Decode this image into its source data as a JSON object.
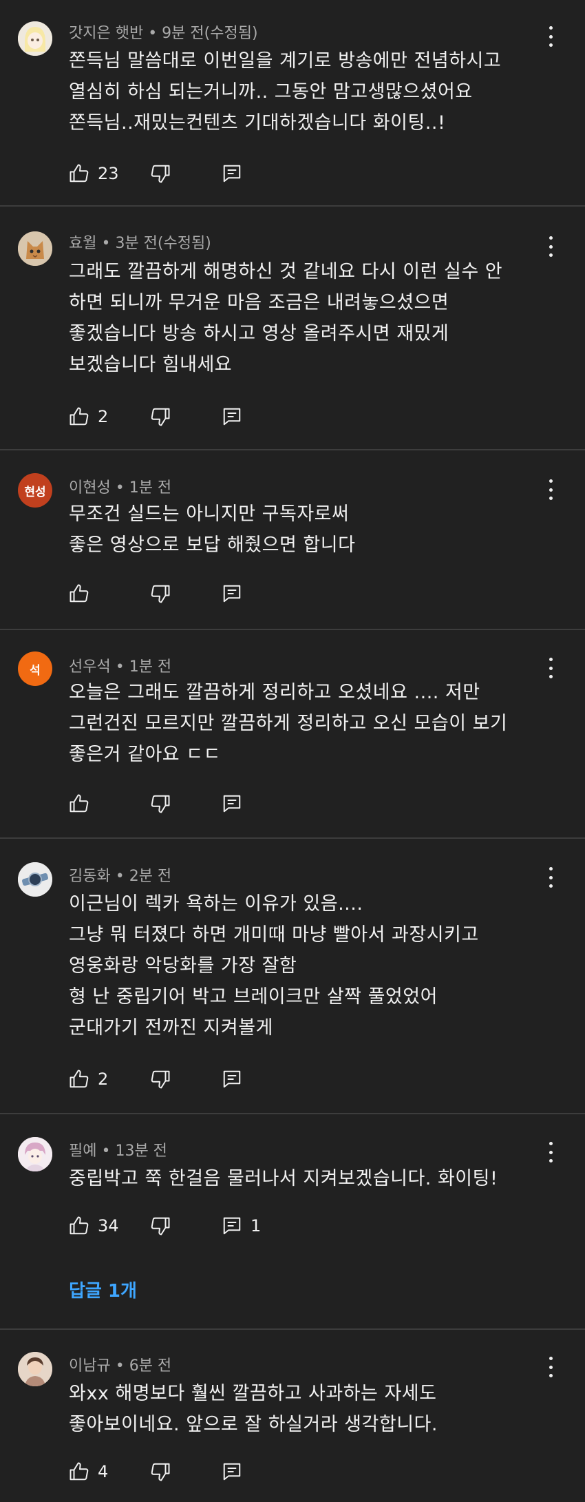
{
  "comments": [
    {
      "author": "갓지은 햇반",
      "time": "9분 전(수정됨)",
      "lines": [
        "쫀득님 말씀대로 이번일을 계기로 방송에만 전념하시고",
        "열심히 하심 되는거니까.. 그동안 맘고생많으셨어요",
        "쫀득님..재밌는컨텐츠 기대하겠습니다 화이팅..!"
      ],
      "likes": "23",
      "reply_count": "",
      "avatar": {
        "type": "image",
        "icon": "anime-character-avatar",
        "bg": "#e9e4dc"
      }
    },
    {
      "author": "효월",
      "time": "3분 전(수정됨)",
      "lines": [
        "그래도 깔끔하게 해명하신 것 같네요 다시 이런 실수 안",
        "하면 되니까 무거운 마음 조금은 내려놓으셨으면",
        "좋겠습니다 방송 하시고 영상 올려주시면 재밌게",
        "보겠습니다 힘내세요"
      ],
      "likes": "2",
      "reply_count": "",
      "avatar": {
        "type": "image",
        "icon": "kitten-avatar",
        "bg": "#c9b9a0"
      }
    },
    {
      "author": "이현성",
      "time": "1분 전",
      "lines": [
        "무조건 실드는 아니지만 구독자로써",
        "좋은 영상으로 보답 해줬으면 합니다"
      ],
      "likes": "",
      "reply_count": "",
      "avatar": {
        "type": "letter",
        "text": "현성",
        "bg": "#c1401e"
      }
    },
    {
      "author": "선우석",
      "time": "1분 전",
      "lines": [
        "오늘은 그래도 깔끔하게 정리하고 오셨네요 .... 저만",
        "그런건진 모르지만 깔끔하게 정리하고 오신 모습이 보기",
        "좋은거 같아요 ㄷㄷ"
      ],
      "likes": "",
      "reply_count": "",
      "avatar": {
        "type": "letter",
        "text": "석",
        "bg": "#f16a12"
      }
    },
    {
      "author": "김동화",
      "time": "2분 전",
      "lines": [
        "이근님이 렉카 욕하는 이유가 있음....",
        "그냥 뭐 터졌다 하면 개미때 마냥 빨아서 과장시키고",
        "영웅화랑 악당화를 가장 잘함",
        "형 난 중립기어 박고 브레이크만 살짝 풀었었어",
        "군대가기 전까진 지켜볼게"
      ],
      "likes": "2",
      "reply_count": "",
      "avatar": {
        "type": "image",
        "icon": "wristwatch-avatar",
        "bg": "#e8e8e8"
      }
    },
    {
      "author": "필예",
      "time": "13분 전",
      "lines": [
        "중립박고 쭉 한걸음 물러나서 지켜보겠습니다. 화이팅!"
      ],
      "likes": "34",
      "reply_count": "1",
      "replies_link": "답글 1개",
      "avatar": {
        "type": "image",
        "icon": "anime-boy-avatar",
        "bg": "#f0e6ee"
      }
    },
    {
      "author": "이남규",
      "time": "6분 전",
      "lines": [
        "와xx 해명보다 훨씬 깔끔하고 사과하는 자세도",
        "좋아보이네요. 앞으로 잘 하실거라 생각합니다."
      ],
      "likes": "4",
      "reply_count": "",
      "avatar": {
        "type": "image",
        "icon": "person-photo-avatar",
        "bg": "#cdb7a6"
      }
    }
  ],
  "separator": " • ",
  "colors": {
    "background": "#212121",
    "text": "#f1f1f1",
    "meta": "#aaaaaa",
    "link": "#3ea6ff",
    "divider": "#3d3d3d"
  }
}
